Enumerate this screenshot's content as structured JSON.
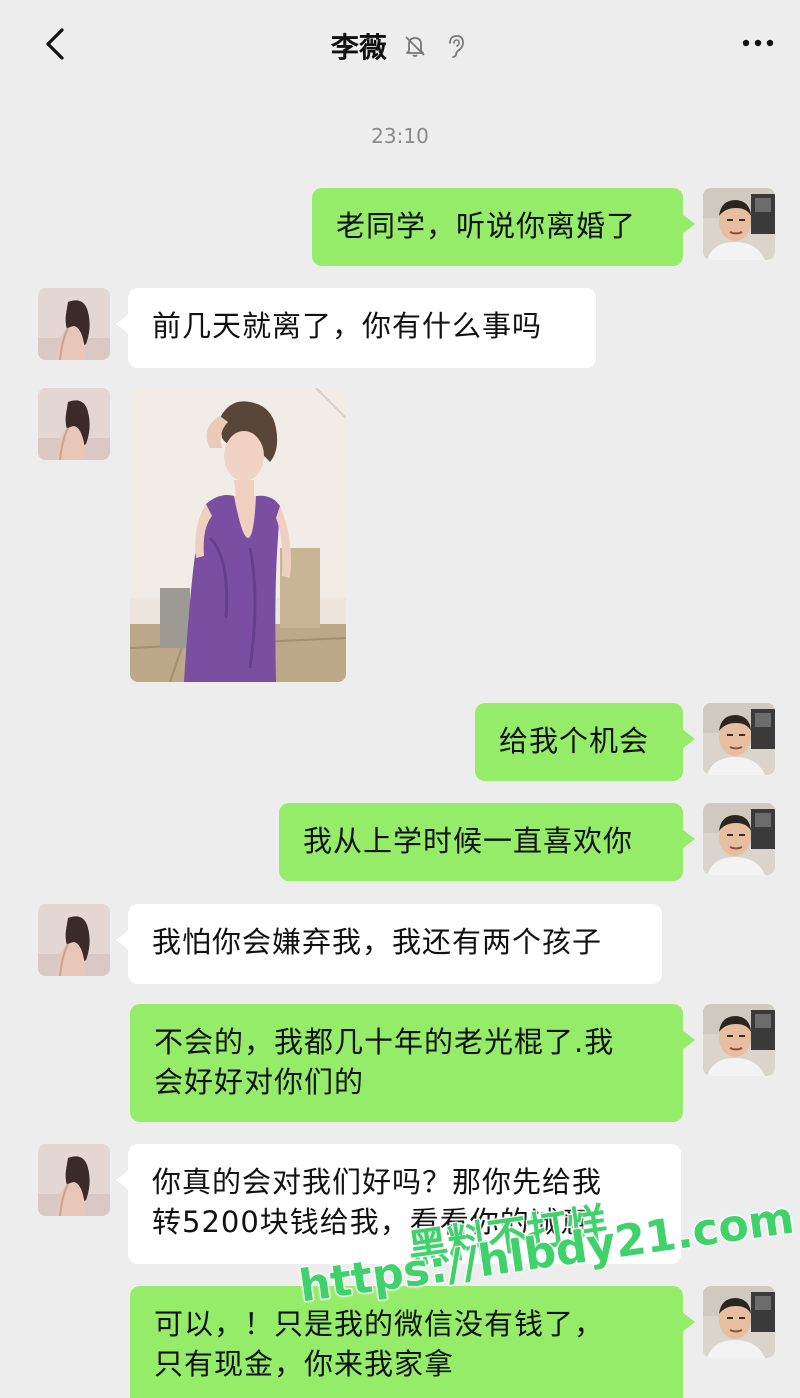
{
  "header": {
    "title": "李薇",
    "back_icon": "chevron-left-icon",
    "mute_icon": "bell-off-icon",
    "ear_icon": "ear-icon",
    "more_icon": "more-dots-icon"
  },
  "timestamp": "23:10",
  "colors": {
    "sent_bubble": "#95ec69",
    "received_bubble": "#ffffff",
    "background": "#ededed",
    "watermark": "#3fd16a"
  },
  "messages": [
    {
      "sender": "me",
      "text": "老同学，听说你离婚了"
    },
    {
      "sender": "other",
      "text": "前几天就离了，你有什么事吗"
    },
    {
      "sender": "other",
      "type": "image"
    },
    {
      "sender": "me",
      "text": "给我个机会"
    },
    {
      "sender": "me",
      "text": "我从上学时候一直喜欢你"
    },
    {
      "sender": "other",
      "text": "我怕你会嫌弃我，我还有两个孩子"
    },
    {
      "sender": "me",
      "line1": "不会的，我都几十年的老光棍了.我",
      "line2": "会好好对你们的"
    },
    {
      "sender": "other",
      "line1": "你真的会对我们好吗？那你先给我",
      "line2": "转5200块钱给我，看看你的诚意"
    },
    {
      "sender": "me",
      "line1": "可以，！只是我的微信没有钱了，",
      "line2": "只有现金，你来我家拿"
    }
  ],
  "watermark": {
    "line1": "黑料不打烊",
    "line2": "https://hlbdy21.com"
  }
}
